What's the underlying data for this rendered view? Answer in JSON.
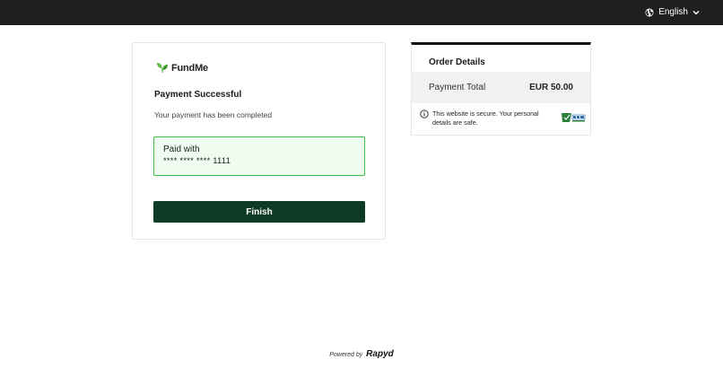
{
  "header": {
    "language_label": "English",
    "globe_icon": "globe-icon",
    "chevron_icon": "chevron-down-icon"
  },
  "payment": {
    "brand_name": "FundMe",
    "title": "Payment Successful",
    "subtitle": "Your payment has been completed",
    "paid_with_label": "Paid with",
    "card_masked": "**** **** **** 1111",
    "finish_label": "Finish",
    "accent_color": "#3fbf4a",
    "button_color": "#0d3b26"
  },
  "order": {
    "title": "Order Details",
    "total_label": "Payment Total",
    "total_value": "EUR 50.00",
    "secure_text": "This website is secure. Your personal details are safe.",
    "info_icon": "info-icon",
    "badge_icon": "pci-dss-badge-icon"
  },
  "footer": {
    "powered_by": "Powered by",
    "brand": "Rapyd"
  }
}
